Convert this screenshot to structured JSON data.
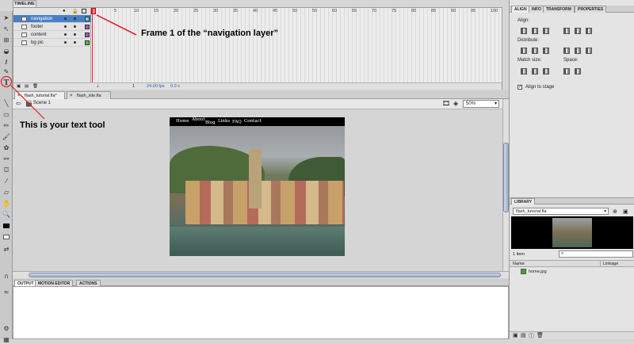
{
  "timeline": {
    "tab_label": "TIMELINE",
    "layers": [
      {
        "name": "navigation",
        "color": "#7fd3e8",
        "selected": true
      },
      {
        "name": "footer",
        "color": "#b04fc4",
        "selected": false
      },
      {
        "name": "content",
        "color": "#b04fc4",
        "selected": false
      },
      {
        "name": "bg pic",
        "color": "#46c24a",
        "selected": false
      }
    ],
    "frame_numbers": [
      "5",
      "10",
      "15",
      "20",
      "25",
      "30",
      "35",
      "40",
      "45",
      "50",
      "55",
      "60",
      "65",
      "70",
      "75",
      "80",
      "85",
      "90",
      "95",
      "100",
      "105"
    ],
    "status": {
      "current_frame": "1",
      "fps": "24.00 fps",
      "time": "0.0 s"
    }
  },
  "document_tabs": [
    {
      "label": "flash_tutorial.fla*",
      "active": true
    },
    {
      "label": "flash_site.fla",
      "active": false
    }
  ],
  "scene": {
    "label": "Scene 1",
    "zoom": "50%"
  },
  "stage": {
    "nav_links": [
      "Home",
      "About",
      "Blog",
      "Links",
      "FAQ",
      "Contact"
    ]
  },
  "output_tabs": [
    {
      "label": "OUTPUT",
      "active": true
    },
    {
      "label": "MOTION EDITOR",
      "active": false
    },
    {
      "label": "ACTIONS",
      "active": false
    }
  ],
  "right_panel": {
    "tabs": [
      {
        "label": "ALIGN",
        "active": true
      },
      {
        "label": "INFO",
        "active": false
      },
      {
        "label": "TRANSFORM",
        "active": false
      },
      {
        "label": "PROPERTIES",
        "active": false
      }
    ],
    "align_label": "Align:",
    "distribute_label": "Distribute:",
    "match_size_label": "Match size:",
    "space_label": "Space:",
    "align_to_stage": "Align to stage"
  },
  "library": {
    "tab_label": "LIBRARY",
    "file": "flash_tutorial.fla",
    "count": "1 item",
    "col_name": "Name",
    "col_linkage": "Linkage",
    "items": [
      "home.jpg"
    ]
  },
  "annotations": {
    "frame_note": "Frame 1 of the “navigation layer”",
    "text_tool_note": "This is your text tool"
  },
  "colors": {
    "accent": "#4b7fc4",
    "annotation_line": "#e0202a"
  }
}
